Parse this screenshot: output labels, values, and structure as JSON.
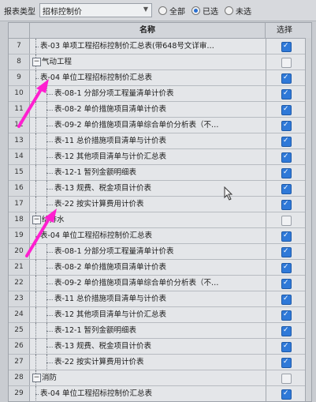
{
  "toolbar": {
    "report_type_label": "报表类型",
    "report_type_value": "招标控制价",
    "radio_all": "全部",
    "radio_selected": "已选",
    "radio_unselected": "未选"
  },
  "table": {
    "col_name": "名称",
    "col_select": "选择",
    "rows": [
      {
        "num": "7",
        "name": "表-03 单项工程招标控制价汇总表(带648号文详审…",
        "level": 2,
        "checked": true,
        "group": false
      },
      {
        "num": "8",
        "name": "气动工程",
        "level": 1,
        "checked": false,
        "group": true
      },
      {
        "num": "9",
        "name": "表-04 单位工程招标控制价汇总表",
        "level": 2,
        "checked": true,
        "group": false
      },
      {
        "num": "10",
        "name": "表-08-1 分部分项工程量清单计价表",
        "level": 3,
        "checked": true,
        "group": false
      },
      {
        "num": "11",
        "name": "表-08-2 单价措施项目清单计价表",
        "level": 3,
        "checked": true,
        "group": false
      },
      {
        "num": "12",
        "name": "表-09-2 单价措施项目清单综合单价分析表（不…",
        "level": 3,
        "checked": true,
        "group": false
      },
      {
        "num": "13",
        "name": "表-11 总价措施项目清单与计价表",
        "level": 3,
        "checked": true,
        "group": false
      },
      {
        "num": "14",
        "name": "表-12 其他项目清单与计价汇总表",
        "level": 3,
        "checked": true,
        "group": false
      },
      {
        "num": "15",
        "name": "表-12-1 暂列金额明细表",
        "level": 3,
        "checked": true,
        "group": false
      },
      {
        "num": "16",
        "name": "表-13 规费、税金项目计价表",
        "level": 3,
        "checked": true,
        "group": false
      },
      {
        "num": "17",
        "name": "表-22 按实计算费用计价表",
        "level": 3,
        "checked": true,
        "group": false
      },
      {
        "num": "18",
        "name": "给排水",
        "level": 1,
        "checked": false,
        "group": true
      },
      {
        "num": "19",
        "name": "表-04 单位工程招标控制价汇总表",
        "level": 2,
        "checked": true,
        "group": false
      },
      {
        "num": "20",
        "name": "表-08-1 分部分项工程量清单计价表",
        "level": 3,
        "checked": true,
        "group": false
      },
      {
        "num": "21",
        "name": "表-08-2 单价措施项目清单计价表",
        "level": 3,
        "checked": true,
        "group": false
      },
      {
        "num": "22",
        "name": "表-09-2 单价措施项目清单综合单价分析表（不…",
        "level": 3,
        "checked": true,
        "group": false
      },
      {
        "num": "23",
        "name": "表-11 总价措施项目清单与计价表",
        "level": 3,
        "checked": true,
        "group": false
      },
      {
        "num": "24",
        "name": "表-12 其他项目清单与计价汇总表",
        "level": 3,
        "checked": true,
        "group": false
      },
      {
        "num": "25",
        "name": "表-12-1 暂列金额明细表",
        "level": 3,
        "checked": true,
        "group": false
      },
      {
        "num": "26",
        "name": "表-13 规费、税金项目计价表",
        "level": 3,
        "checked": true,
        "group": false
      },
      {
        "num": "27",
        "name": "表-22 按实计算费用计价表",
        "level": 3,
        "checked": true,
        "group": false
      },
      {
        "num": "28",
        "name": "消防",
        "level": 1,
        "checked": false,
        "group": true
      },
      {
        "num": "29",
        "name": "表-04 单位工程招标控制价汇总表",
        "level": 2,
        "checked": true,
        "group": false
      }
    ]
  },
  "colors": {
    "check_on": "#2f79d8",
    "annotation_arrow": "#ff1fd0"
  },
  "icons": [
    "collapse-icon",
    "checkbox-icon",
    "mouse-cursor-icon",
    "annotation-arrow-icon"
  ]
}
